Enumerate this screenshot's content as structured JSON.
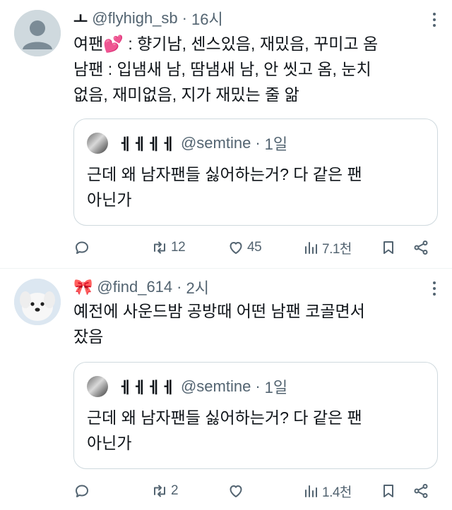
{
  "tweets": [
    {
      "name": "ㅗ",
      "handle": "@flyhigh_sb",
      "dot": "·",
      "time": "16시",
      "text_lines": [
        "여팬",
        "💕",
        ": 향기남, 센스있음, 재밌음, 꾸미고 옴",
        "남팬 : 입냄새 남, 땀냄새 남, 안 씻고 옴, 눈치",
        "없음, 재미없음, 지가 재밌는 줄 앎"
      ],
      "quote": {
        "name": "ㅔㅔㅔㅔ",
        "handle": "@semtine",
        "dot": "·",
        "time": "1일",
        "text_lines": [
          "근데 왜 남자팬들 싫어하는거? 다 같은 팬",
          "아닌가"
        ]
      },
      "actions": {
        "retweets": "12",
        "likes": "45",
        "views": "7.1천"
      }
    },
    {
      "name": "🎀",
      "handle": "@find_614",
      "dot": "·",
      "time": "2시",
      "text_lines": [
        "예전에 사운드밤 공방때 어떤 남팬 코골면서",
        "잤음"
      ],
      "quote": {
        "name": "ㅔㅔㅔㅔ",
        "handle": "@semtine",
        "dot": "·",
        "time": "1일",
        "text_lines": [
          "근데 왜 남자팬들 싫어하는거? 다 같은 팬",
          "아닌가"
        ]
      },
      "actions": {
        "retweets": "2",
        "likes": "",
        "views": "1.4천"
      }
    }
  ],
  "colors": {
    "text": "#0f1419",
    "muted": "#536471",
    "border": "#cfd9de",
    "heart": "#ff6fb1"
  },
  "icons": [
    "reply-icon",
    "retweet-icon",
    "like-icon",
    "views-icon",
    "bookmark-icon",
    "share-icon",
    "more-icon"
  ]
}
